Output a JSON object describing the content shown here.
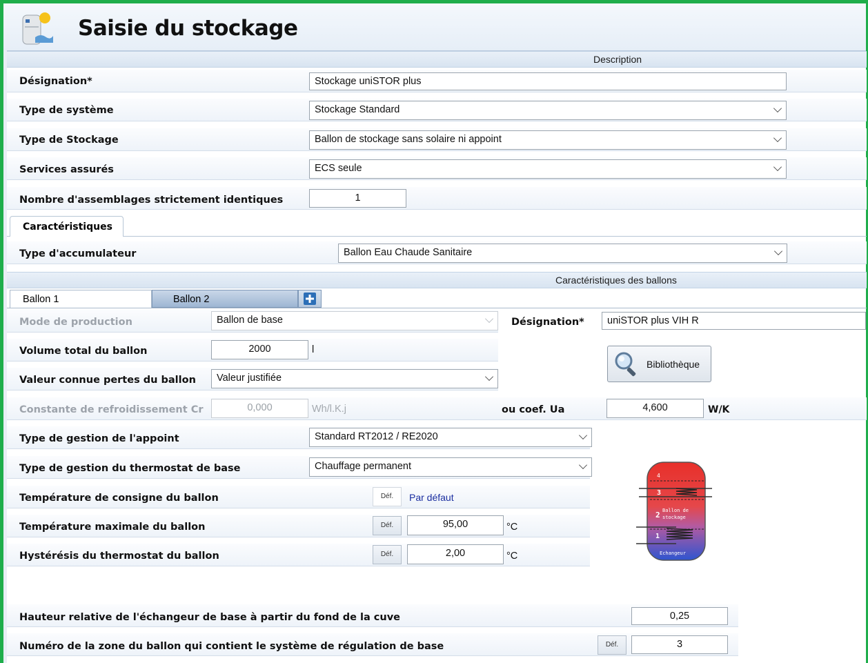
{
  "header": {
    "title": "Saisie du stockage",
    "app_icon": "water-heater-sun-icon"
  },
  "sections": {
    "description": "Description",
    "caracteristiques_ballons": "Caractéristiques des ballons"
  },
  "form": {
    "designation": {
      "label": "Désignation*",
      "value": "Stockage uniSTOR plus"
    },
    "type_systeme": {
      "label": "Type de système",
      "value": "Stockage Standard"
    },
    "type_stockage": {
      "label": "Type de Stockage",
      "value": "Ballon de stockage sans solaire ni appoint"
    },
    "services": {
      "label": "Services assurés",
      "value": "ECS seule"
    },
    "nombre": {
      "label": "Nombre d'assemblages strictement identiques",
      "value": "1"
    }
  },
  "tabs": {
    "caracteristiques": "Caractéristiques"
  },
  "accumulateur": {
    "label": "Type d'accumulateur",
    "value": "Ballon Eau Chaude Sanitaire"
  },
  "ballon_tabs": [
    "Ballon 1",
    "Ballon 2"
  ],
  "add_tab_icon": "plus-icon",
  "ballon": {
    "mode_production": {
      "label": "Mode de production",
      "value": "Ballon de base"
    },
    "designation": {
      "label": "Désignation*",
      "value": "uniSTOR plus VIH R"
    },
    "volume": {
      "label": "Volume total du ballon",
      "value": "2000",
      "unit": "l"
    },
    "bibliotheque": "Bibliothèque",
    "valeur_connue": {
      "label": "Valeur connue pertes du ballon",
      "value": "Valeur justifiée"
    },
    "constante": {
      "label": "Constante de refroidissement  Cr",
      "value": "0,000",
      "unit": "Wh/l.K.j"
    },
    "coef_ua": {
      "label": "ou coef.  Ua",
      "value": "4,600",
      "unit": "W/K"
    },
    "gestion_appoint": {
      "label": "Type de gestion de l'appoint",
      "value": "Standard RT2012 / RE2020"
    },
    "gestion_thermostat": {
      "label": "Type de gestion du thermostat de base",
      "value": "Chauffage permanent"
    },
    "temp_consigne": {
      "label": "Température de consigne du ballon",
      "def": "Déf.",
      "note": "Par défaut"
    },
    "temp_max": {
      "label": "Température maximale du ballon",
      "def": "Déf.",
      "value": "95,00",
      "unit": "°C"
    },
    "hysteresis": {
      "label": "Hystérésis du thermostat du ballon",
      "def": "Déf.",
      "value": "2,00",
      "unit": "°C"
    },
    "hauteur_relative": {
      "label": "Hauteur relative de l'échangeur de base à partir du fond de la cuve",
      "value": "0,25"
    },
    "numero_zone": {
      "label": "Numéro de la zone du ballon qui contient le système de régulation de base",
      "def": "Déf.",
      "value": "3"
    }
  },
  "diagram": {
    "zone4": "4",
    "zone3": "3",
    "zone2": "2",
    "zone1": "1",
    "ballon_text": "Ballon de",
    "stockage_text": "stockage",
    "echangeur_text": "Echangeur"
  }
}
